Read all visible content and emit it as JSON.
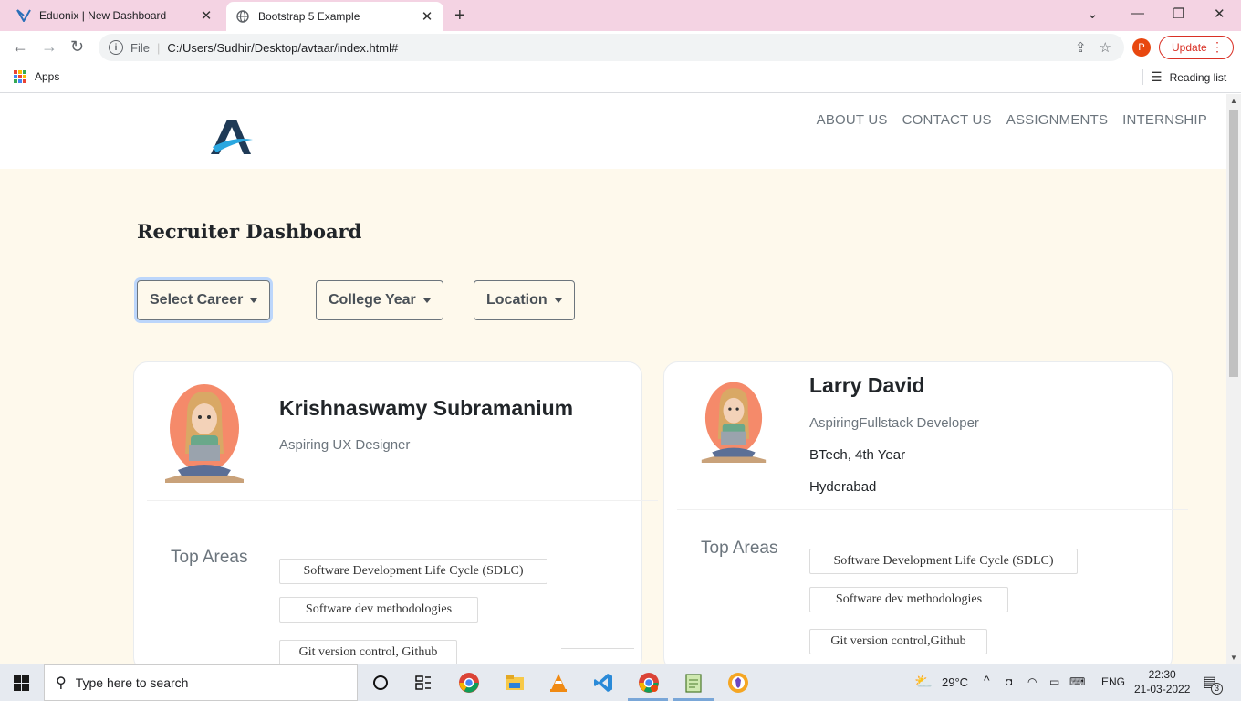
{
  "browser": {
    "tabs": [
      {
        "title": "Eduonix | New Dashboard",
        "active": false
      },
      {
        "title": "Bootstrap 5 Example",
        "active": true
      }
    ],
    "address": {
      "scheme_label": "File",
      "url": "C:/Users/Sudhir/Desktop/avtaar/index.html#"
    },
    "profile_initial": "P",
    "update_label": "Update",
    "bookmarks": {
      "apps_label": "Apps",
      "reading_list_label": "Reading list"
    }
  },
  "site": {
    "nav": [
      "ABOUT US",
      "CONTACT US",
      "ASSIGNMENTS",
      "INTERNSHIP"
    ],
    "page_title": "Recruiter Dashboard",
    "filters": [
      "Select Career",
      "College Year",
      "Location"
    ]
  },
  "candidates": [
    {
      "name": "Krishnaswamy Subramanium",
      "role": "Aspiring UX Designer",
      "top_areas_label": "Top Areas",
      "skills": [
        "Software Development Life Cycle (SDLC)",
        "Software dev methodologies",
        "Git version control, Github"
      ]
    },
    {
      "name": "Larry David",
      "role": "AspiringFullstack Developer",
      "year": "BTech, 4th Year",
      "location": "Hyderabad",
      "top_areas_label": "Top Areas",
      "skills": [
        "Software Development Life Cycle (SDLC)",
        "Software dev methodologies",
        "Git version control,Github"
      ]
    }
  ],
  "taskbar": {
    "search_placeholder": "Type here to search",
    "weather": "29°C",
    "language": "ENG",
    "time": "22:30",
    "date": "21-03-2022",
    "notification_count": "3",
    "icons": [
      "task-view-icon",
      "widgets-icon",
      "chrome-icon",
      "file-explorer-icon",
      "vlc-icon",
      "vscode-icon",
      "chrome-profile-icon",
      "notepad-icon",
      "brave-icon"
    ]
  },
  "colors": {
    "page_bg": "#fef9ec",
    "tabbar_bg": "#f4d3e3",
    "update_red": "#d93025"
  }
}
